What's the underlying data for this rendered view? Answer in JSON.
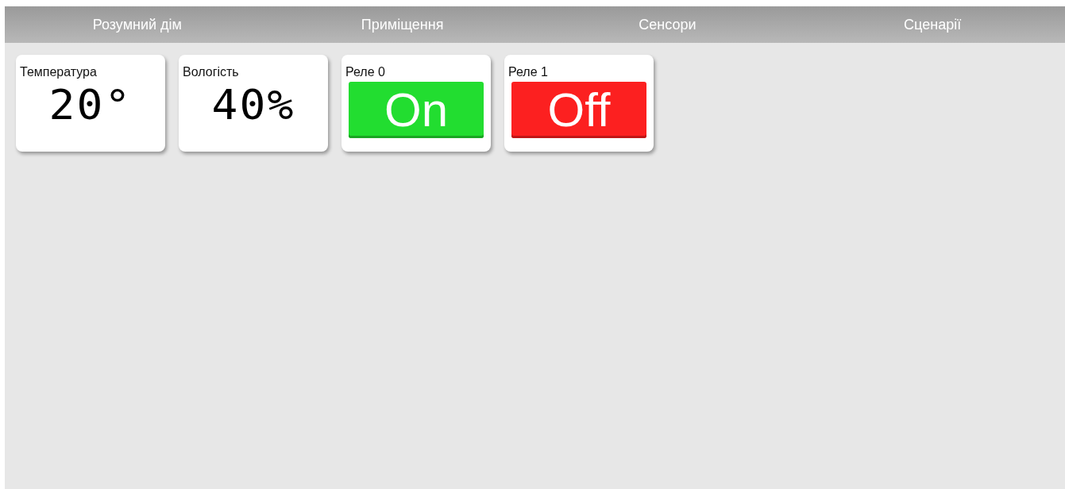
{
  "nav": [
    {
      "label": "Розумний дім"
    },
    {
      "label": "Приміщення"
    },
    {
      "label": "Сенсори"
    },
    {
      "label": "Сценарії"
    }
  ],
  "widgets": [
    {
      "kind": "sensor",
      "title": "Температура",
      "value": "20°"
    },
    {
      "kind": "sensor",
      "title": "Вологість",
      "value": "40%"
    },
    {
      "kind": "relay",
      "title": "Реле 0",
      "on": true,
      "state_label": "On"
    },
    {
      "kind": "relay",
      "title": "Реле 1",
      "on": false,
      "state_label": "Off"
    }
  ]
}
